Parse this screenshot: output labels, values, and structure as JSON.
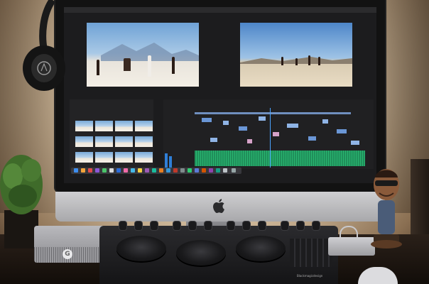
{
  "colors": {
    "wall_light": "#f2e6d3",
    "screen_ui": "#1c1c1e",
    "timeline_clip": "#8fb4e6",
    "audio_track": "#29b470",
    "playhead": "#4aa3ff"
  },
  "icons": {
    "apple_logo": "apple-icon",
    "drive_logo": "g-logo-icon"
  },
  "drive": {
    "logo": "G"
  },
  "console": {
    "brand": "Blackmagicdesign"
  }
}
